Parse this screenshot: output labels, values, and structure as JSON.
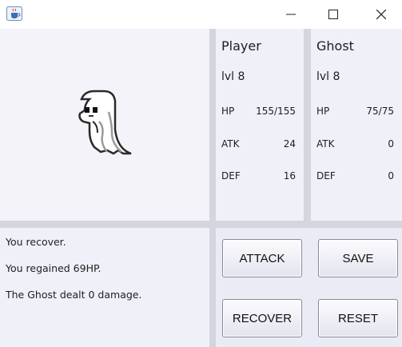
{
  "window": {
    "app_icon": "java-cup-icon"
  },
  "player": {
    "name": "Player",
    "level": "lvl 8",
    "hp_label": "HP",
    "hp": "155/155",
    "atk_label": "ATK",
    "atk": "24",
    "def_label": "DEF",
    "def": "16"
  },
  "enemy": {
    "name": "Ghost",
    "level": "lvl 8",
    "hp_label": "HP",
    "hp": "75/75",
    "atk_label": "ATK",
    "atk": "0",
    "def_label": "DEF",
    "def": "0",
    "sprite": "ghost-sprite"
  },
  "log": [
    "You recover.",
    "You regained 69HP.",
    "The Ghost dealt 0 damage."
  ],
  "buttons": {
    "attack": "ATTACK",
    "save": "SAVE",
    "recover": "RECOVER",
    "reset": "RESET"
  }
}
